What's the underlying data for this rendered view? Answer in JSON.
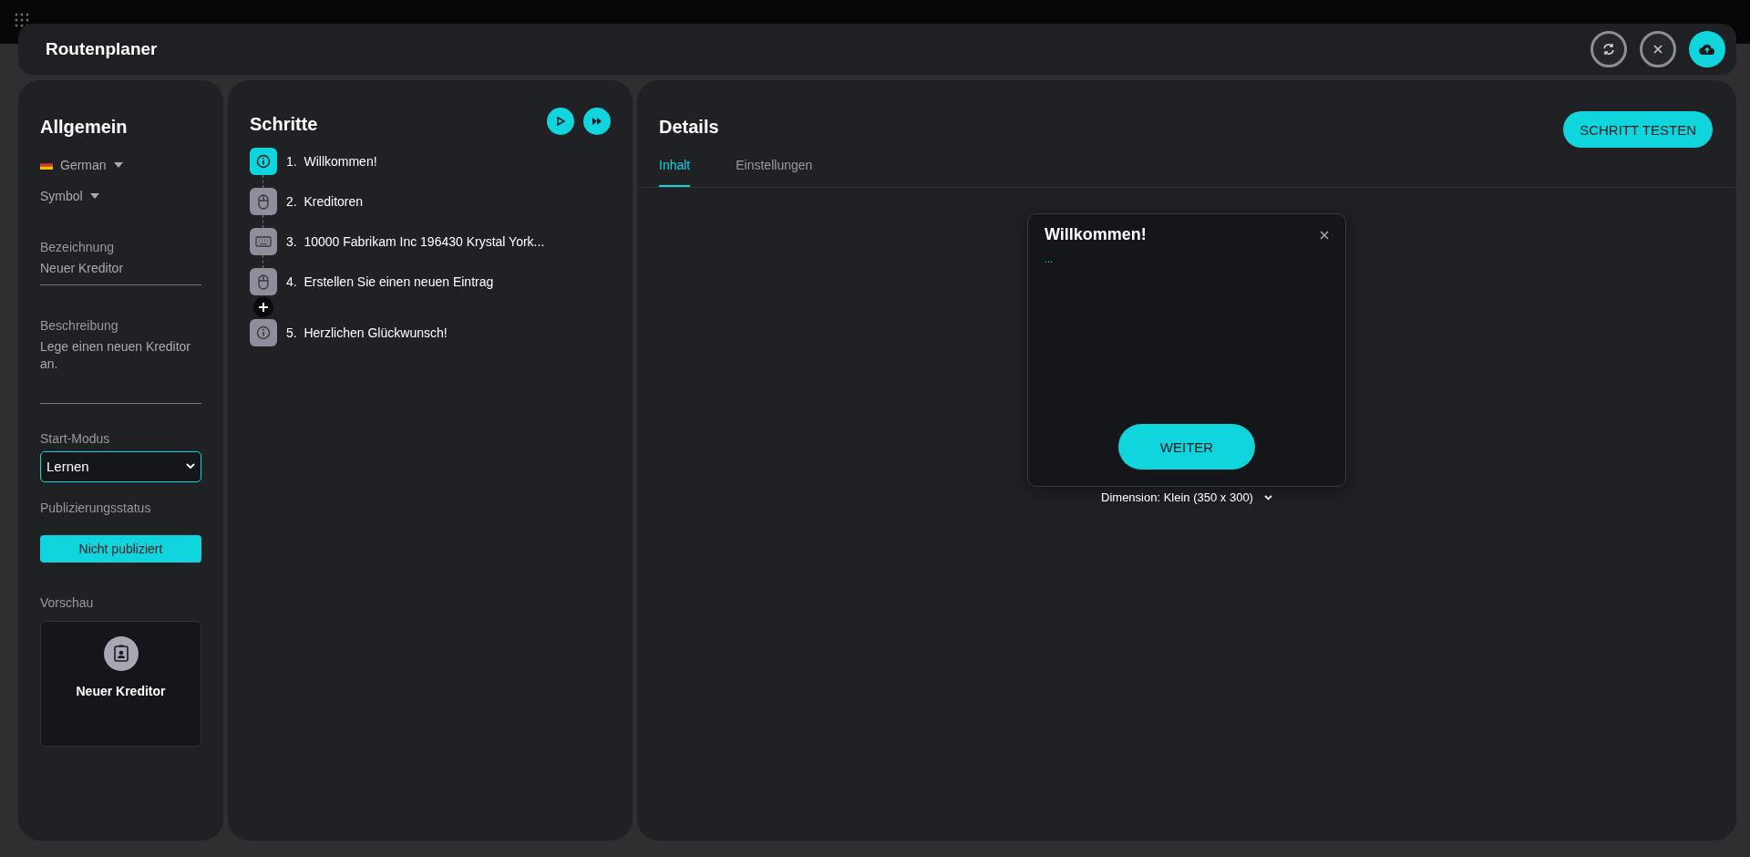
{
  "header": {
    "title": "Routenplaner"
  },
  "general": {
    "title": "Allgemein",
    "language": "German",
    "symbol": "Symbol",
    "name_label": "Bezeichnung",
    "name_value": "Neuer Kreditor",
    "description_label": "Beschreibung",
    "description_value": "Lege einen neuen Kreditor an.",
    "start_mode_label": "Start-Modus",
    "start_mode": "Lernen",
    "publish_label": "Publizierungsstatus",
    "publish_status": "Nicht publiziert",
    "preview_label": "Vorschau",
    "preview_title": "Neuer Kreditor"
  },
  "steps": {
    "title": "Schritte",
    "items": [
      {
        "label": "1.  Willkommen!",
        "kind": "info",
        "selected": true
      },
      {
        "label": "2.  Kreditoren",
        "kind": "mouse",
        "selected": false
      },
      {
        "label": "3.  10000 Fabrikam Inc 196430 Krystal York...",
        "kind": "keyboard",
        "selected": false
      },
      {
        "label": "4.  Erstellen Sie einen neuen Eintrag",
        "kind": "mouse",
        "selected": false
      },
      {
        "label": "5.  Herzlichen Glückwunsch!",
        "kind": "info",
        "selected": false
      }
    ]
  },
  "details": {
    "title": "Details",
    "test_button": "SCHRITT TESTEN",
    "tabs": [
      {
        "label": "Inhalt",
        "selected": true
      },
      {
        "label": "Einstellungen",
        "selected": false
      }
    ],
    "dialog": {
      "title": "Willkommen!",
      "body": "...",
      "button": "WEITER"
    },
    "dimension": "Dimension: Klein (350 x 300)"
  }
}
